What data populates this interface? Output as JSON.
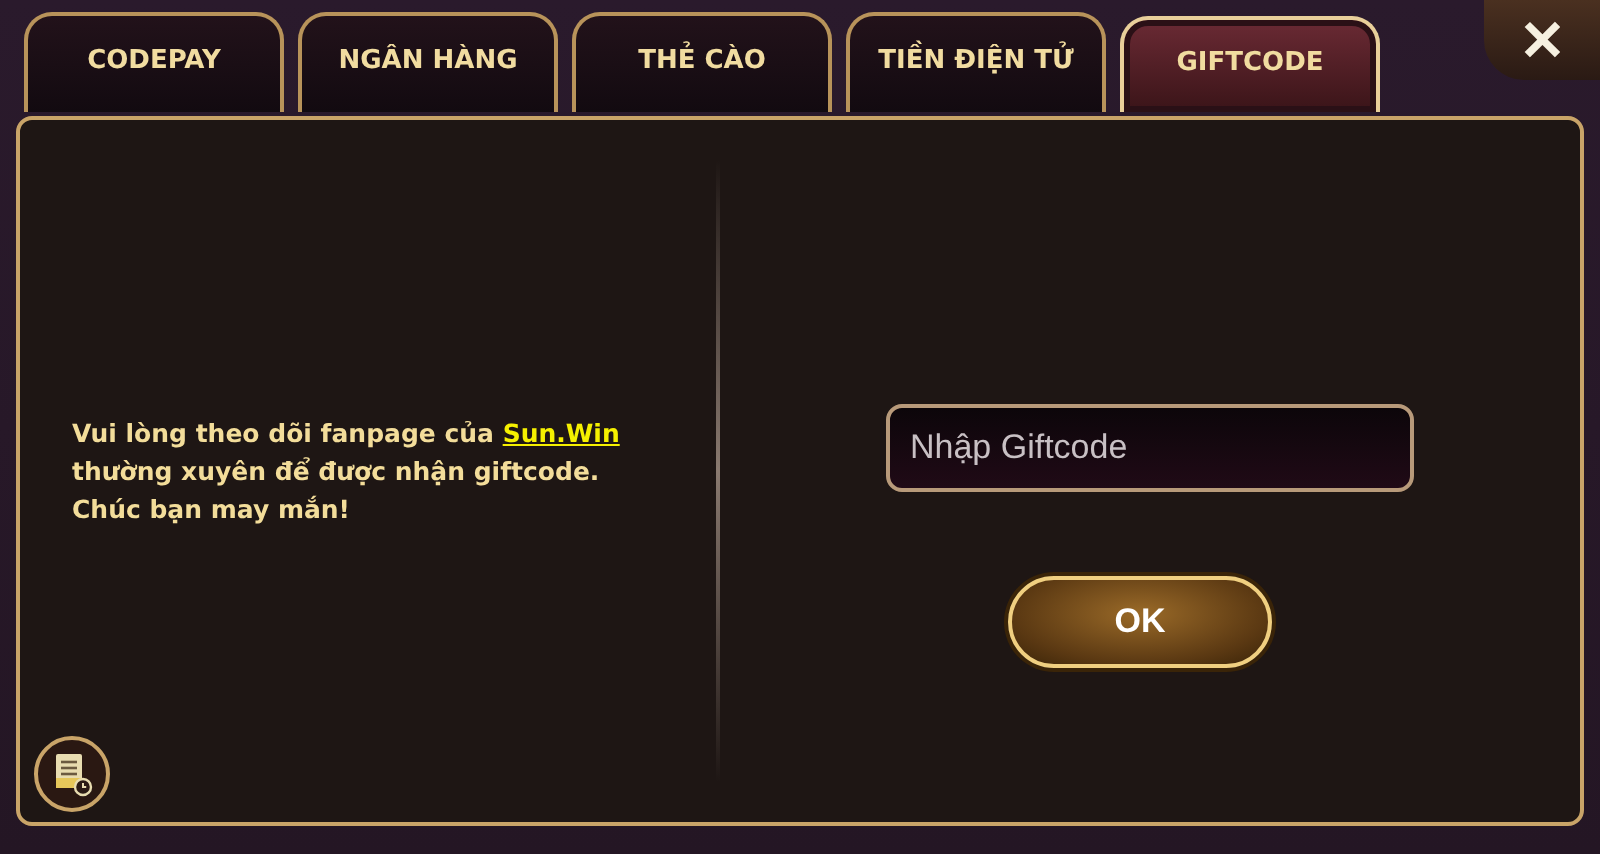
{
  "tabs": [
    {
      "label": "CODEPAY",
      "selected": false
    },
    {
      "label": "NGÂN HÀNG",
      "selected": false
    },
    {
      "label": "THẺ CÀO",
      "selected": false
    },
    {
      "label": "TIỀN ĐIỆN TỬ",
      "selected": false
    },
    {
      "label": "GIFTCODE",
      "selected": true
    }
  ],
  "close_button": {
    "label": "✕"
  },
  "message": {
    "before": "Vui lòng theo dõi fanpage của ",
    "link": "Sun.Win",
    "after": " thường xuyên để được nhận giftcode. Chúc bạn may mắn!"
  },
  "giftcode_field": {
    "placeholder": "Nhập Giftcode"
  },
  "ok_button": {
    "label": "OK"
  }
}
